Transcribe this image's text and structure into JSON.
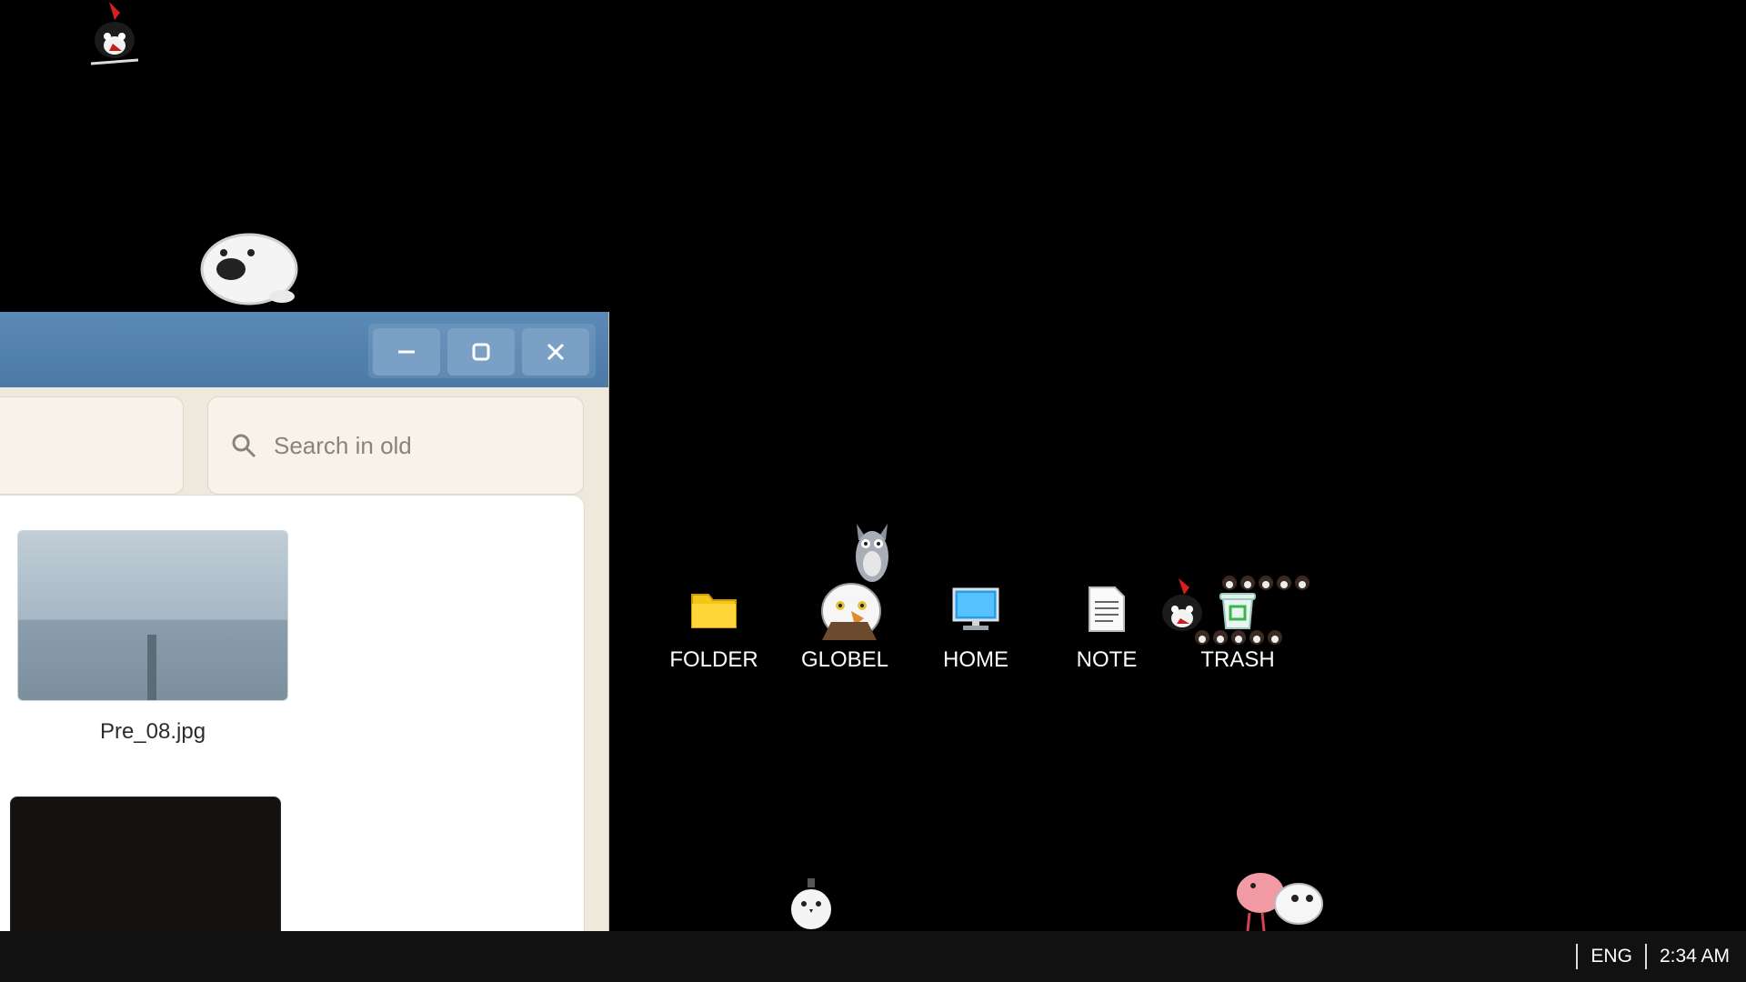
{
  "window": {
    "controls": {
      "minimize_icon": "minimize-icon",
      "maximize_icon": "maximize-icon",
      "close_icon": "close-icon"
    },
    "search": {
      "placeholder": "Search in old",
      "value": ""
    },
    "files": [
      {
        "name": "Pre_08.jpg",
        "thumbnail": "gray foggy landscape with a pole"
      },
      {
        "name": "",
        "thumbnail": "dark image"
      }
    ]
  },
  "desktop": {
    "icons": [
      {
        "label": "FOLDER",
        "icon": "folder-icon"
      },
      {
        "label": "GLOBEL",
        "icon": "globe-icon"
      },
      {
        "label": "HOME",
        "icon": "monitor-icon"
      },
      {
        "label": "NOTE",
        "icon": "note-icon"
      },
      {
        "label": "TRASH",
        "icon": "trash-icon"
      }
    ]
  },
  "taskbar": {
    "language": "ENG",
    "clock": "2:34 AM"
  },
  "colors": {
    "titlebar": "#5b8ab7",
    "window_bg": "#efe8dc",
    "desktop_bg": "#000000",
    "taskbar_bg": "#111111"
  }
}
